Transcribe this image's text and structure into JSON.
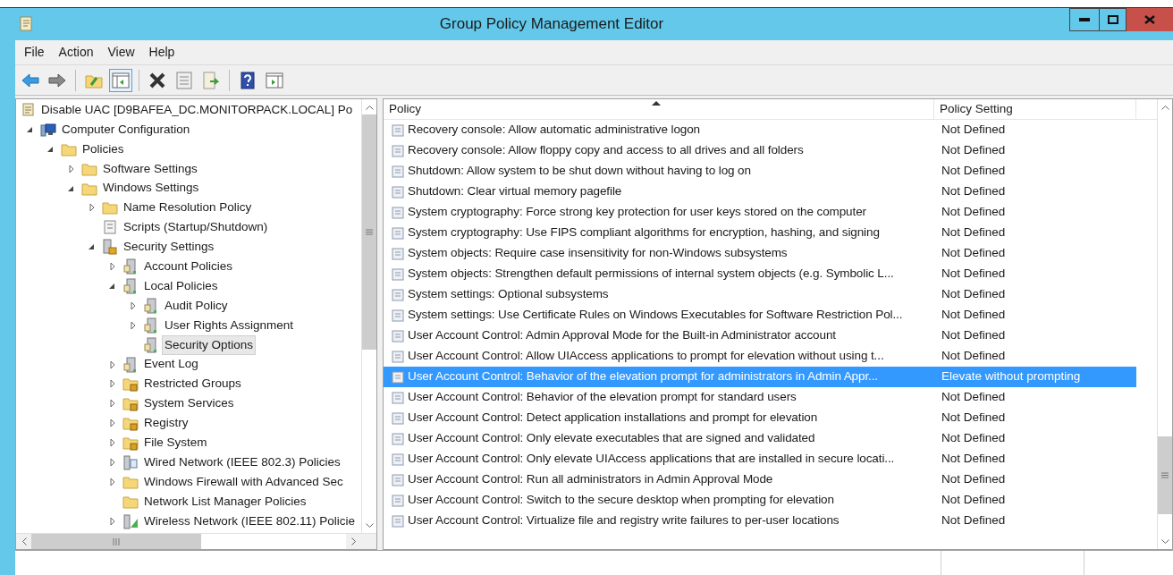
{
  "window": {
    "title": "Group Policy Management Editor"
  },
  "menu": [
    "File",
    "Action",
    "View",
    "Help"
  ],
  "toolbar": [
    {
      "kind": "back",
      "pressed": false
    },
    {
      "kind": "forward",
      "pressed": false
    },
    {
      "kind": "sep"
    },
    {
      "kind": "up",
      "pressed": false
    },
    {
      "kind": "tree",
      "pressed": true
    },
    {
      "kind": "sep"
    },
    {
      "kind": "delete",
      "pressed": false
    },
    {
      "kind": "properties",
      "pressed": false
    },
    {
      "kind": "export",
      "pressed": false
    },
    {
      "kind": "sep"
    },
    {
      "kind": "help",
      "pressed": false
    },
    {
      "kind": "action",
      "pressed": false
    }
  ],
  "tree": [
    {
      "label": "Disable UAC [D9BAFEA_DC.MONITORPACK.LOCAL] Po",
      "kind": "scroll",
      "selected": false,
      "children": [
        {
          "label": "Computer Configuration",
          "kind": "computer",
          "expanded": true,
          "selected": false,
          "children": [
            {
              "label": "Policies",
              "kind": "folder",
              "expanded": true,
              "selected": false,
              "children": [
                {
                  "label": "Software Settings",
                  "kind": "folder",
                  "expanded": false,
                  "selected": false
                },
                {
                  "label": "Windows Settings",
                  "kind": "folder",
                  "expanded": true,
                  "selected": false,
                  "children": [
                    {
                      "label": "Name Resolution Policy",
                      "kind": "folder",
                      "expanded": false,
                      "selected": false
                    },
                    {
                      "label": "Scripts (Startup/Shutdown)",
                      "kind": "script",
                      "selected": false
                    },
                    {
                      "label": "Security Settings",
                      "kind": "security",
                      "expanded": true,
                      "selected": false,
                      "children": [
                        {
                          "label": "Account Policies",
                          "kind": "server",
                          "expanded": false,
                          "selected": false
                        },
                        {
                          "label": "Local Policies",
                          "kind": "server",
                          "expanded": true,
                          "selected": false,
                          "children": [
                            {
                              "label": "Audit Policy",
                              "kind": "server",
                              "expanded": false,
                              "selected": false
                            },
                            {
                              "label": "User Rights Assignment",
                              "kind": "server",
                              "expanded": false,
                              "selected": false
                            },
                            {
                              "label": "Security Options",
                              "kind": "server",
                              "selected": true
                            }
                          ]
                        },
                        {
                          "label": "Event Log",
                          "kind": "server",
                          "expanded": false,
                          "selected": false
                        },
                        {
                          "label": "Restricted Groups",
                          "kind": "lock",
                          "expanded": false,
                          "selected": false
                        },
                        {
                          "label": "System Services",
                          "kind": "lock",
                          "expanded": false,
                          "selected": false
                        },
                        {
                          "label": "Registry",
                          "kind": "lock",
                          "expanded": false,
                          "selected": false
                        },
                        {
                          "label": "File System",
                          "kind": "lock",
                          "expanded": false,
                          "selected": false
                        },
                        {
                          "label": "Wired Network (IEEE 802.3) Policies",
                          "kind": "network",
                          "expanded": false,
                          "selected": false
                        },
                        {
                          "label": "Windows Firewall with Advanced Sec",
                          "kind": "folder",
                          "expanded": false,
                          "selected": false
                        },
                        {
                          "label": "Network List Manager Policies",
                          "kind": "folder",
                          "selected": false
                        },
                        {
                          "label": "Wireless Network (IEEE 802.11) Policie",
                          "kind": "wireless",
                          "expanded": false,
                          "selected": false
                        }
                      ]
                    }
                  ]
                }
              ]
            }
          ]
        }
      ]
    }
  ],
  "table": {
    "columns": [
      "Policy",
      "Policy Setting"
    ],
    "rows": [
      {
        "policy": "Recovery console: Allow automatic administrative logon",
        "setting": "Not Defined",
        "selected": false
      },
      {
        "policy": "Recovery console: Allow floppy copy and access to all drives and all folders",
        "setting": "Not Defined",
        "selected": false
      },
      {
        "policy": "Shutdown: Allow system to be shut down without having to log on",
        "setting": "Not Defined",
        "selected": false
      },
      {
        "policy": "Shutdown: Clear virtual memory pagefile",
        "setting": "Not Defined",
        "selected": false
      },
      {
        "policy": "System cryptography: Force strong key protection for user keys stored on the computer",
        "setting": "Not Defined",
        "selected": false
      },
      {
        "policy": "System cryptography: Use FIPS compliant algorithms for encryption, hashing, and signing",
        "setting": "Not Defined",
        "selected": false
      },
      {
        "policy": "System objects: Require case insensitivity for non-Windows subsystems",
        "setting": "Not Defined",
        "selected": false
      },
      {
        "policy": "System objects: Strengthen default permissions of internal system objects (e.g. Symbolic L...",
        "setting": "Not Defined",
        "selected": false
      },
      {
        "policy": "System settings: Optional subsystems",
        "setting": "Not Defined",
        "selected": false
      },
      {
        "policy": "System settings: Use Certificate Rules on Windows Executables for Software Restriction Pol...",
        "setting": "Not Defined",
        "selected": false
      },
      {
        "policy": "User Account Control: Admin Approval Mode for the Built-in Administrator account",
        "setting": "Not Defined",
        "selected": false
      },
      {
        "policy": "User Account Control: Allow UIAccess applications to prompt for elevation without using t...",
        "setting": "Not Defined",
        "selected": false
      },
      {
        "policy": "User Account Control: Behavior of the elevation prompt for administrators in Admin Appr...",
        "setting": "Elevate without prompting",
        "selected": true
      },
      {
        "policy": "User Account Control: Behavior of the elevation prompt for standard users",
        "setting": "Not Defined",
        "selected": false
      },
      {
        "policy": "User Account Control: Detect application installations and prompt for elevation",
        "setting": "Not Defined",
        "selected": false
      },
      {
        "policy": "User Account Control: Only elevate executables that are signed and validated",
        "setting": "Not Defined",
        "selected": false
      },
      {
        "policy": "User Account Control: Only elevate UIAccess applications that are installed in secure locati...",
        "setting": "Not Defined",
        "selected": false
      },
      {
        "policy": "User Account Control: Run all administrators in Admin Approval Mode",
        "setting": "Not Defined",
        "selected": false
      },
      {
        "policy": "User Account Control: Switch to the secure desktop when prompting for elevation",
        "setting": "Not Defined",
        "selected": false
      },
      {
        "policy": "User Account Control: Virtualize file and registry write failures to per-user locations",
        "setting": "Not Defined",
        "selected": false
      }
    ]
  }
}
